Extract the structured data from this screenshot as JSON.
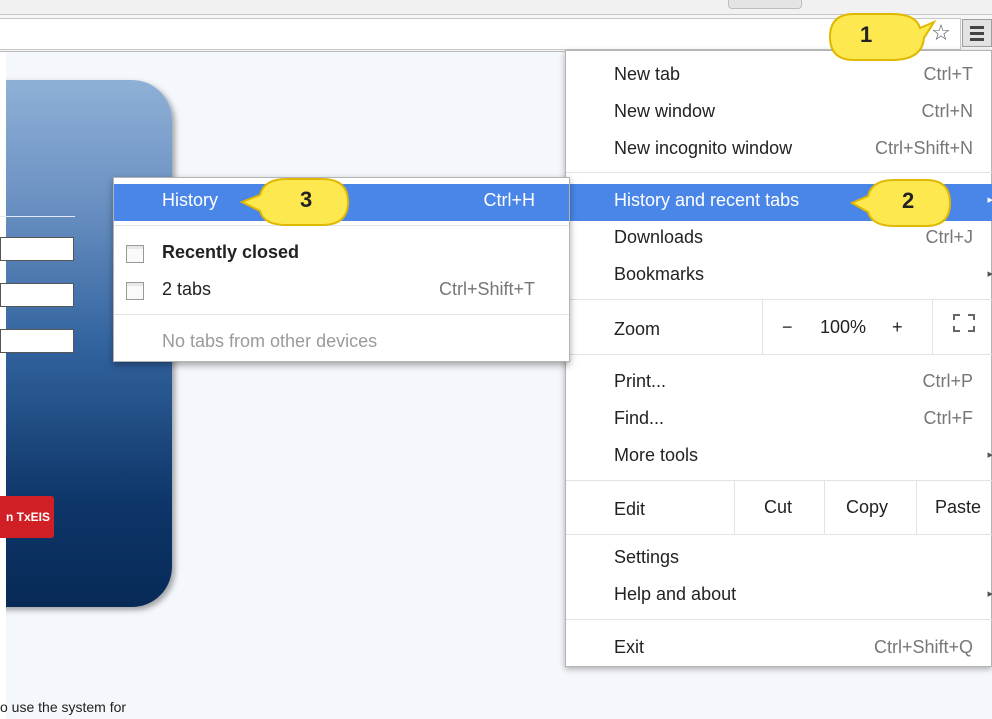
{
  "page": {
    "footer_text": "o use the system for",
    "login_button_label": "n TxEIS"
  },
  "main_menu": {
    "items": [
      {
        "label": "New tab",
        "shortcut": "Ctrl+T"
      },
      {
        "label": "New window",
        "shortcut": "Ctrl+N"
      },
      {
        "label": "New incognito window",
        "shortcut": "Ctrl+Shift+N"
      },
      {
        "label": "History and recent tabs",
        "shortcut": ""
      },
      {
        "label": "Downloads",
        "shortcut": "Ctrl+J"
      },
      {
        "label": "Bookmarks",
        "shortcut": ""
      }
    ],
    "zoom": {
      "label": "Zoom",
      "minus": "−",
      "level": "100%",
      "plus": "+"
    },
    "items2": [
      {
        "label": "Print...",
        "shortcut": "Ctrl+P"
      },
      {
        "label": "Find...",
        "shortcut": "Ctrl+F"
      },
      {
        "label": "More tools",
        "shortcut": ""
      }
    ],
    "edit": {
      "label": "Edit",
      "cut": "Cut",
      "copy": "Copy",
      "paste": "Paste"
    },
    "items3": [
      {
        "label": "Settings"
      },
      {
        "label": "Help and about"
      }
    ],
    "exit": {
      "label": "Exit",
      "shortcut": "Ctrl+Shift+Q"
    },
    "submenu_arrow": "▸"
  },
  "history_menu": {
    "history": {
      "label": "History",
      "shortcut": "Ctrl+H"
    },
    "recently_closed": "Recently closed",
    "two_tabs": {
      "label": "2 tabs",
      "shortcut": "Ctrl+Shift+T"
    },
    "no_devices": "No tabs from other devices"
  },
  "callouts": [
    "1",
    "2",
    "3"
  ],
  "colors": {
    "highlight": "#4a86e8",
    "callout_fill": "#fde84f",
    "callout_stroke": "#e0b800",
    "txeis_red": "#d11f26"
  },
  "icons": {
    "star": "star-icon",
    "menu": "hamburger-menu-icon",
    "fullscreen": "fullscreen-icon",
    "page": "page-icon"
  }
}
